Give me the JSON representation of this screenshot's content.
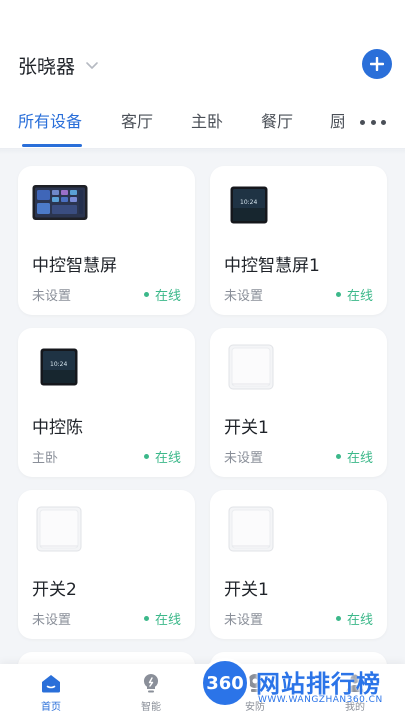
{
  "header": {
    "home_name": "张晓器",
    "tabs": [
      {
        "label": "所有设备",
        "active": true
      },
      {
        "label": "客厅",
        "active": false
      },
      {
        "label": "主卧",
        "active": false
      },
      {
        "label": "餐厅",
        "active": false
      },
      {
        "label": "厨",
        "active": false
      }
    ]
  },
  "devices": [
    {
      "name": "中控智慧屏",
      "room": "未设置",
      "status": "在线",
      "thumb": "panel-wide",
      "screen_time": ""
    },
    {
      "name": "中控智慧屏1",
      "room": "未设置",
      "status": "在线",
      "thumb": "panel-square",
      "screen_time": "10:24"
    },
    {
      "name": "中控陈",
      "room": "主卧",
      "status": "在线",
      "thumb": "panel-square",
      "screen_time": "10:24"
    },
    {
      "name": "开关1",
      "room": "未设置",
      "status": "在线",
      "thumb": "switch",
      "screen_time": ""
    },
    {
      "name": "开关2",
      "room": "未设置",
      "status": "在线",
      "thumb": "switch",
      "screen_time": ""
    },
    {
      "name": "开关1",
      "room": "未设置",
      "status": "在线",
      "thumb": "switch",
      "screen_time": ""
    }
  ],
  "tabbar": [
    {
      "label": "首页",
      "icon": "home-icon",
      "active": true
    },
    {
      "label": "智能",
      "icon": "bulb-icon",
      "active": false
    },
    {
      "label": "安防",
      "icon": "camera-icon",
      "active": false
    },
    {
      "label": "我的",
      "icon": "user-icon",
      "active": false
    }
  ],
  "watermark": {
    "badge": "360",
    "title": "网站排行榜",
    "subtitle": "WWW.WANGZHAN360.CN"
  },
  "colors": {
    "accent": "#2a6fd9",
    "online": "#3cb88a",
    "background": "#f3f5f8"
  }
}
